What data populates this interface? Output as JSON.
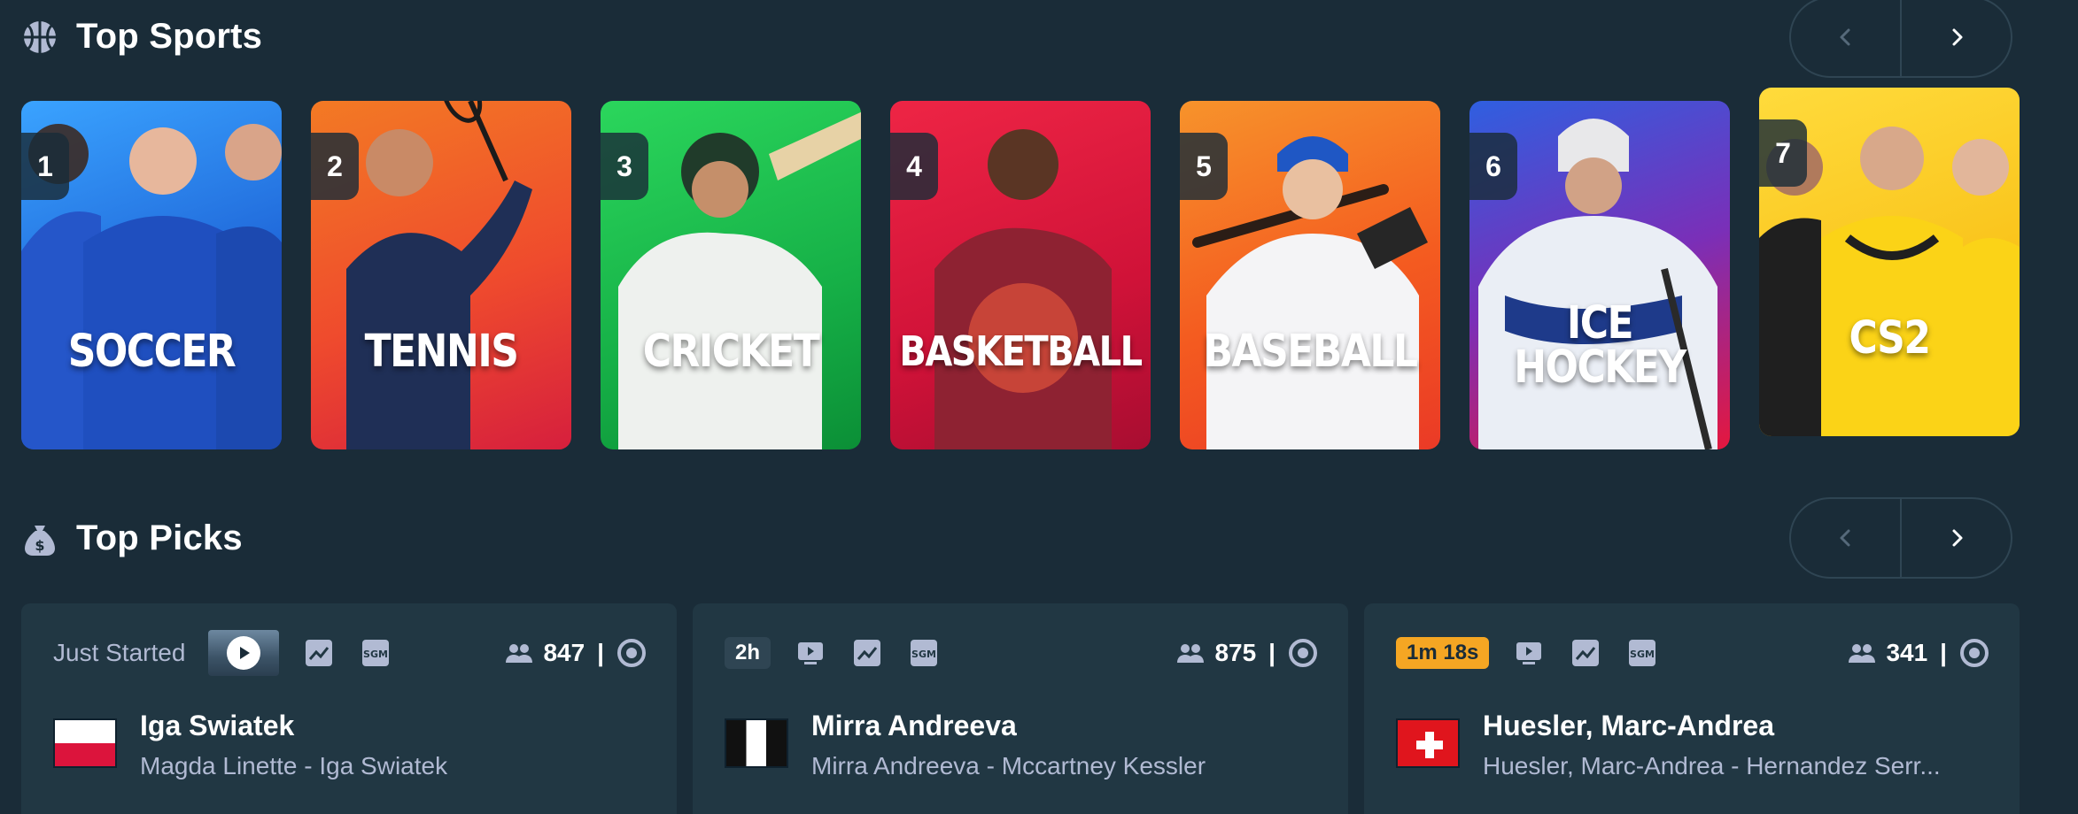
{
  "top_sports": {
    "title": "Top Sports",
    "header_icon": "basketball-icon",
    "nav": {
      "prev_icon": "chevron-left-icon",
      "next_icon": "chevron-right-icon"
    },
    "cards": [
      {
        "rank": "1",
        "label": "SOCCER",
        "colors": [
          "#2f8ff0",
          "#1552c9"
        ]
      },
      {
        "rank": "2",
        "label": "TENNIS",
        "colors": [
          "#f05a28",
          "#d8233a"
        ]
      },
      {
        "rank": "3",
        "label": "CRICKET",
        "colors": [
          "#23c552",
          "#0c9a3b"
        ]
      },
      {
        "rank": "4",
        "label": "BASKETBALL",
        "colors": [
          "#e4163b",
          "#b80f37"
        ]
      },
      {
        "rank": "5",
        "label": "BASEBALL",
        "colors": [
          "#f7641d",
          "#ee3a24"
        ]
      },
      {
        "rank": "6",
        "label": "ICE",
        "label2": "HOCKEY",
        "colors": [
          "#3653d8",
          "#e0143f"
        ]
      },
      {
        "rank": "7",
        "label": "CS2",
        "colors": [
          "#ffd02a",
          "#f5b40d"
        ]
      }
    ]
  },
  "top_picks": {
    "title": "Top Picks",
    "header_icon": "money-bag-icon",
    "nav": {
      "prev_icon": "chevron-left-icon",
      "next_icon": "chevron-right-icon"
    },
    "cards": [
      {
        "status": "Just Started",
        "count": "847",
        "player": "Iga Swiatek",
        "match": "Magda Linette - Iga Swiatek",
        "flag": "poland-flag"
      },
      {
        "time": "2h",
        "time_bg": "#2f4553",
        "time_fg": "#ffffff",
        "count": "875",
        "player": "Mirra Andreeva",
        "match": "Mirra Andreeva - Mccartney Kessler",
        "flag": "neutral-flag"
      },
      {
        "time": "1m 18s",
        "time_bg": "#f5a623",
        "time_fg": "#1a2c38",
        "count": "341",
        "player": "Huesler, Marc-Andrea",
        "match": "Huesler, Marc-Andrea - Hernandez Serr...",
        "flag": "switzerland-flag"
      }
    ],
    "row_icons": [
      "trend-chart-icon",
      "sgm-icon",
      "stream-icon",
      "users-icon",
      "stake-coin-icon"
    ]
  },
  "colors": {
    "background": "#1a2c38",
    "card_bg": "#213743",
    "border": "#2f4553",
    "muted_text": "#b1bad3"
  }
}
